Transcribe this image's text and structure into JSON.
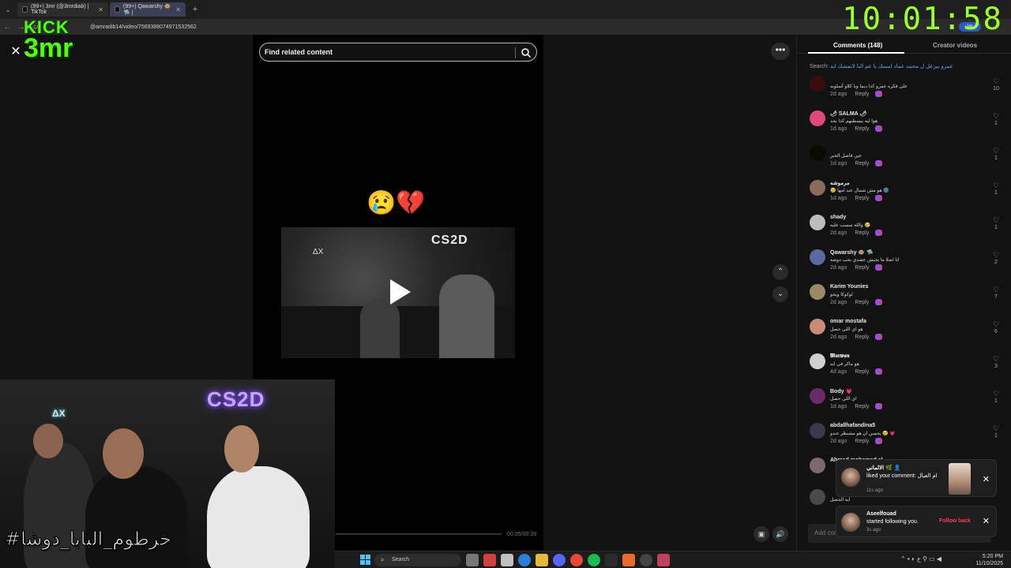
{
  "browser": {
    "tabs": [
      {
        "label": "(99+) 3mr (@3mrdiab) | TikTok",
        "active": false
      },
      {
        "label": "(99+) Qawarshy 🐵 🛸 |",
        "active": true
      }
    ],
    "new_tab_label": "+",
    "url": "@amradib14/video/7569388074971532562"
  },
  "overlay": {
    "logo_line1": "KICK",
    "logo_line2": "3mr",
    "clock": "10:01:58"
  },
  "player": {
    "close_icon": "✕",
    "search_placeholder": "Find related content",
    "emojis": "😢💔",
    "more_label": "•••",
    "time_label": "00:05/00:39"
  },
  "comments_panel": {
    "tabs": {
      "comments": "Comments (148)",
      "creator": "Creator videos"
    },
    "search_prefix": "Search:",
    "search_query": "عمرو بيزعل ل محمد عماد امسك يا عم النا لانمشك ايه",
    "input_placeholder": "Add comment...",
    "reply_label": "Reply",
    "comments": [
      {
        "name": "",
        "text": "على فكره عمرو كدا ديما وبا كلاو أسلوبه",
        "time": "2d ago",
        "likes": "10",
        "avatar_color": "#3a0d0d"
      },
      {
        "name": "🌶 SALMA 🌶",
        "text": "هوا ليه بيسطيهم كدا بجد",
        "time": "1d ago",
        "likes": "1",
        "avatar_color": "#e04a7a"
      },
      {
        "name": "",
        "text": "عين فاضل الخير",
        "time": "1d ago",
        "likes": "1",
        "avatar_color": "#0a0a00"
      },
      {
        "name": "مرموشه",
        "text": "😢 هو مش شمال عند امها 🌚",
        "time": "1d ago",
        "likes": "1",
        "avatar_color": "#8a6a5a"
      },
      {
        "name": "shady",
        "text": "والله سسب عليه 😢",
        "time": "2d ago",
        "likes": "1",
        "avatar_color": "#bdbdbd"
      },
      {
        "name": "Qawarshy 🐵 🛸",
        "text": "انا اصلا ما بحبش عشدي بحب دوشه",
        "time": "2d ago",
        "likes": "2",
        "avatar_color": "#5a6aa0"
      },
      {
        "name": "Karim Younies",
        "text": "لوكوكا ويجو",
        "time": "2d ago",
        "likes": "7",
        "avatar_color": "#9a8a6a"
      },
      {
        "name": "omar mostafa",
        "text": "هو اي اللي حصل",
        "time": "2d ago",
        "likes": "6",
        "avatar_color": "#c98a7a"
      },
      {
        "name": "𝕸𝖆𝖗𝖜𝖆𝖓",
        "text": "هو ماكر في ايه",
        "time": "4d ago",
        "likes": "3",
        "avatar_color": "#d0d0d0"
      },
      {
        "name": "Body 💗",
        "text": "اي اللي حصل",
        "time": "1d ago",
        "likes": "1",
        "avatar_color": "#6a2a6a"
      },
      {
        "name": "abdallhafandina5",
        "text": "يحسن ان هو مشنظر عندو 😢 💗",
        "time": "2d ago",
        "likes": "1",
        "avatar_color": "#3a3a4a"
      },
      {
        "name": "Ahmed mohamed el...",
        "text": "",
        "time": "",
        "likes": "",
        "avatar_color": "#7a6a6a"
      },
      {
        "name": "",
        "text": "ايه الحصل",
        "time": "",
        "likes": "",
        "avatar_color": "#4a4a4a"
      }
    ]
  },
  "notifications": [
    {
      "user": "الالماني 🌿 👤",
      "message": "liked your comment: ام العيال",
      "time": "11s ago",
      "action": ""
    },
    {
      "user": "Aseelfouad",
      "message": "started following you.",
      "time": "3s ago",
      "action": "Follow back"
    }
  ],
  "webcam": {
    "neon_sign": "CS2D",
    "neon_small": "ΔX",
    "caption": "#خرطوم_البابا_دوشا"
  },
  "taskbar": {
    "search_label": "Search",
    "time": "5:20 PM",
    "date": "11/10/2025",
    "lang": "ع"
  }
}
